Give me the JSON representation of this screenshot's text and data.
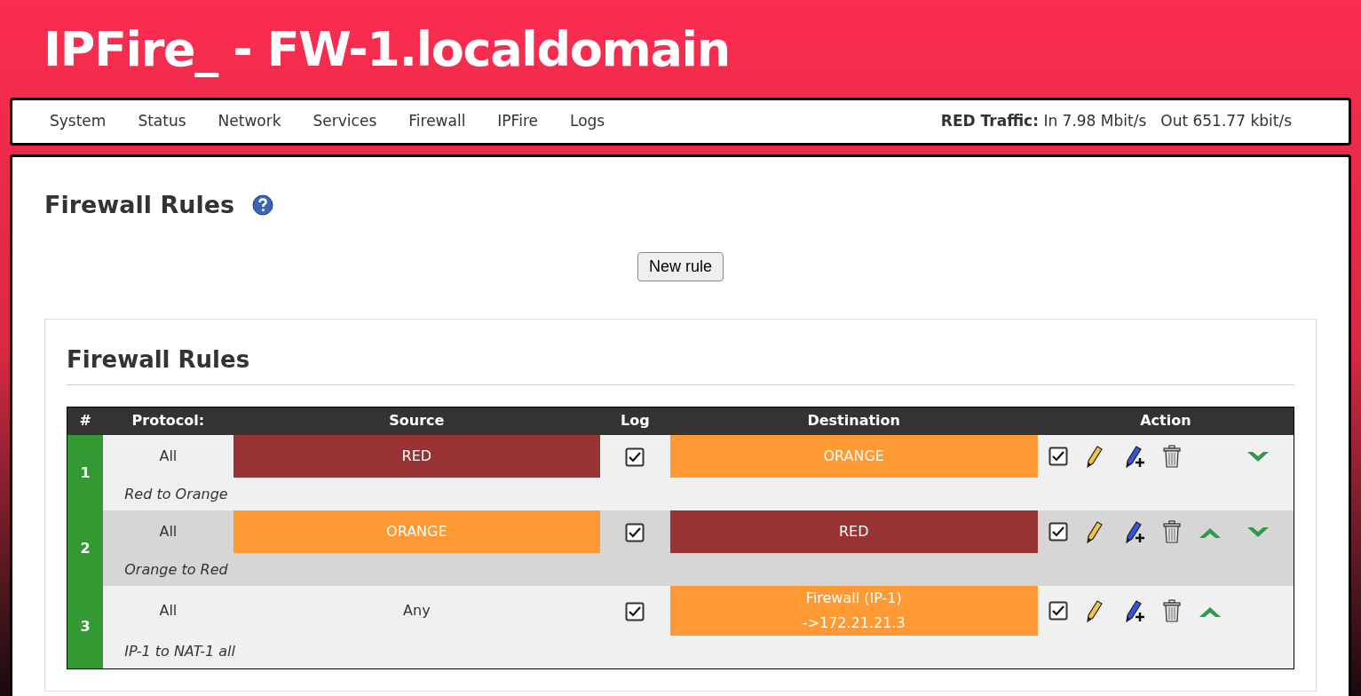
{
  "header": {
    "title": "IPFire_ - FW-1.localdomain"
  },
  "nav": {
    "items": [
      "System",
      "Status",
      "Network",
      "Services",
      "Firewall",
      "IPFire",
      "Logs"
    ],
    "traffic_label": "RED Traffic:",
    "traffic_in": "In 7.98 Mbit/s",
    "traffic_out": "Out 651.77 kbit/s"
  },
  "page": {
    "title": "Firewall Rules",
    "new_rule_button": "New rule"
  },
  "rules_box": {
    "title": "Firewall Rules",
    "columns": [
      "#",
      "Protocol:",
      "Source",
      "Log",
      "Destination",
      "Action"
    ],
    "rows": [
      {
        "number": "1",
        "protocol": "All",
        "source": {
          "lines": [
            "RED"
          ],
          "color": "#993333"
        },
        "log": true,
        "destination": {
          "lines": [
            "ORANGE"
          ],
          "color": "#ff9933"
        },
        "enabled": true,
        "can_move_up": false,
        "can_move_down": true,
        "remark": "Red to Orange"
      },
      {
        "number": "2",
        "protocol": "All",
        "source": {
          "lines": [
            "ORANGE"
          ],
          "color": "#ff9933"
        },
        "log": true,
        "destination": {
          "lines": [
            "RED"
          ],
          "color": "#993333"
        },
        "enabled": true,
        "can_move_up": true,
        "can_move_down": true,
        "remark": "Orange to Red"
      },
      {
        "number": "3",
        "protocol": "All",
        "source": {
          "lines": [
            "Any"
          ]
        },
        "log": true,
        "destination": {
          "lines": [
            "Firewall (IP-1)",
            "->172.21.21.3"
          ],
          "color": "#ff9933"
        },
        "enabled": true,
        "can_move_up": true,
        "can_move_down": false,
        "remark": "IP-1 to NAT-1 all"
      }
    ]
  }
}
